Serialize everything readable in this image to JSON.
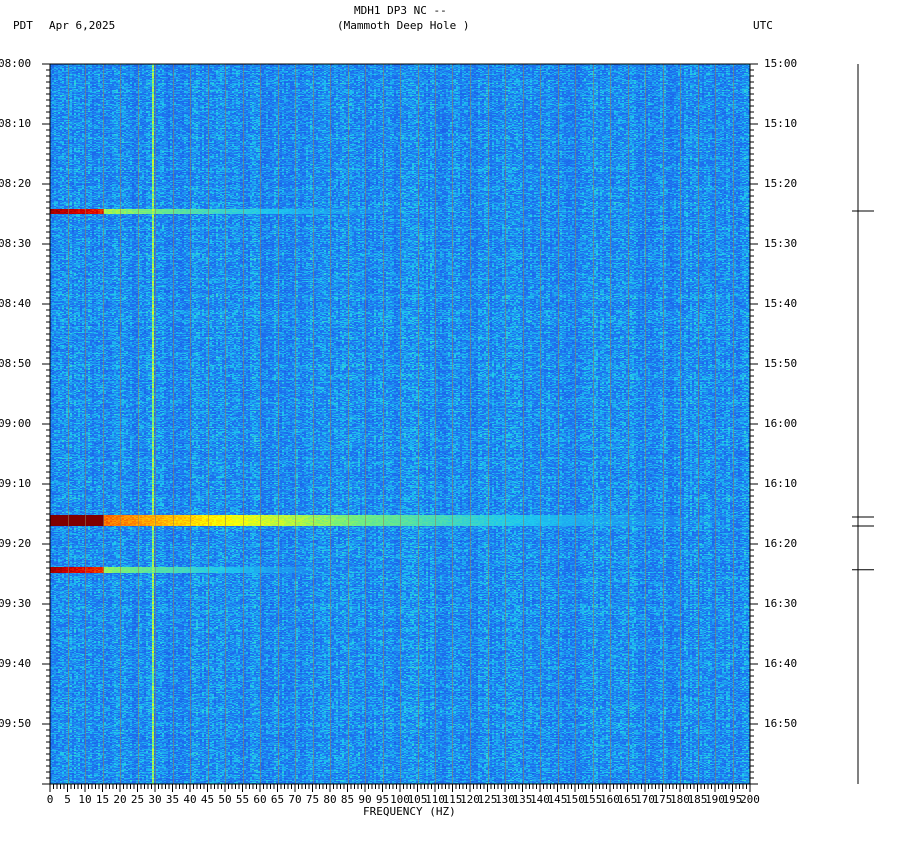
{
  "header": {
    "title": "MDH1 DP3 NC --",
    "subtitle": "(Mammoth Deep Hole )",
    "left_timezone": "PDT",
    "date": "Apr 6,2025",
    "right_timezone": "UTC"
  },
  "chart_data": {
    "type": "heatmap",
    "title": "MDH1 DP3 NC --",
    "subtitle": "(Mammoth Deep Hole )",
    "xlabel": "FREQUENCY (HZ)",
    "xlim": [
      0,
      200
    ],
    "x_ticks": [
      "0",
      "5",
      "10",
      "15",
      "20",
      "25",
      "30",
      "35",
      "40",
      "45",
      "50",
      "55",
      "60",
      "65",
      "70",
      "75",
      "80",
      "85",
      "90",
      "95",
      "100",
      "105",
      "110",
      "115",
      "120",
      "125",
      "130",
      "135",
      "140",
      "145",
      "150",
      "155",
      "160",
      "165",
      "170",
      "175",
      "180",
      "185",
      "190",
      "195",
      "200"
    ],
    "y_left_ticks": [
      "08:00",
      "08:10",
      "08:20",
      "08:30",
      "08:40",
      "08:50",
      "09:00",
      "09:10",
      "09:20",
      "09:30",
      "09:40",
      "09:50"
    ],
    "y_right_ticks": [
      "15:00",
      "15:10",
      "15:20",
      "15:30",
      "15:40",
      "15:50",
      "16:00",
      "16:10",
      "16:20",
      "16:30",
      "16:40",
      "16:50"
    ],
    "y_range_minutes": [
      0,
      120
    ],
    "background_level": "low (blue)",
    "persistent_line_hz": 29,
    "events": [
      {
        "time_pdt": "08:24.5",
        "minute": 24.5,
        "max_freq_hz": 125,
        "strength": 0.85
      },
      {
        "time_pdt": "09:16",
        "minute": 76,
        "max_freq_hz": 200,
        "strength": 1.0
      },
      {
        "time_pdt": "09:24.3",
        "minute": 84.3,
        "max_freq_hz": 100,
        "strength": 0.85
      }
    ],
    "event_marker_minutes": [
      24.5,
      75.5,
      77,
      84.3
    ],
    "colors": {
      "low": "#1f5fe0",
      "mid": "#22c8f0",
      "high": "#ffff00",
      "max": "#800000"
    }
  }
}
